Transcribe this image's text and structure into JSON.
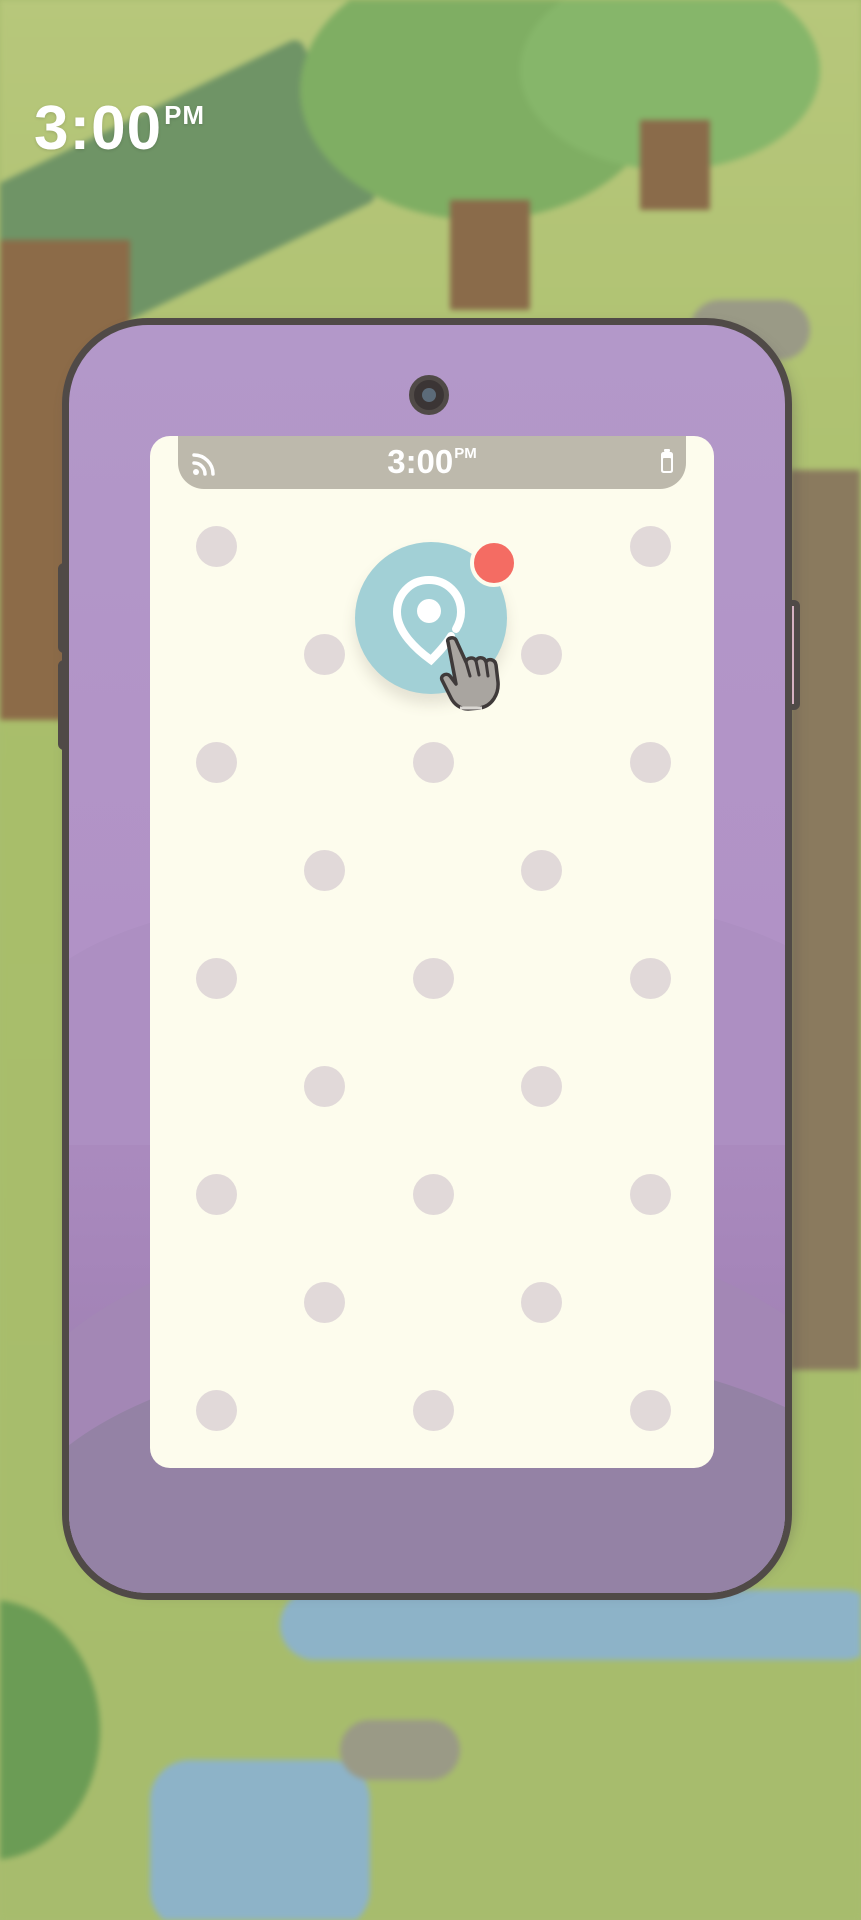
{
  "clock": {
    "time": "3:00",
    "ampm": "PM"
  },
  "phone": {
    "status_bar": {
      "time": "3:00",
      "ampm": "PM",
      "left_icon": "signal-icon",
      "right_icon": "battery-icon"
    },
    "apps": [
      {
        "name": "map-pin-app",
        "icon": "map-pin-icon",
        "has_badge": true
      }
    ],
    "empty_slots": 22
  },
  "colors": {
    "phone_body": "#b398c9",
    "screen": "#fdfced",
    "slot_dot": "#e1d9d9",
    "app_icon_bg": "#a2d0d6",
    "badge": "#f46c63",
    "outline": "#504a47"
  }
}
